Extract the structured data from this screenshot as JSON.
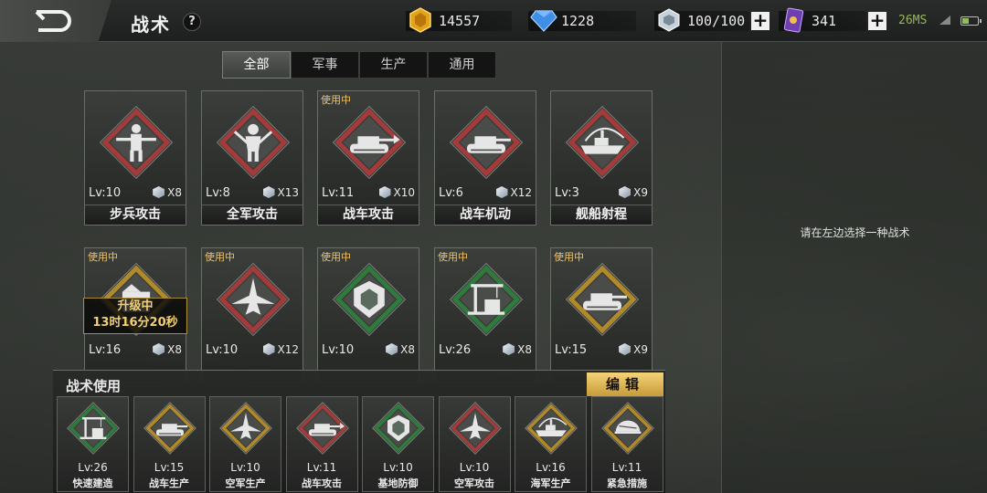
{
  "header": {
    "title": "战术",
    "help_glyph": "?",
    "resources": [
      {
        "name": "gold-coin-icon",
        "value": "14557"
      },
      {
        "name": "diamond-icon",
        "value": "1228"
      },
      {
        "name": "crystal-cube-icon",
        "value": "100/100"
      },
      {
        "name": "purple-card-icon",
        "value": "341"
      }
    ],
    "plus_glyph": "+",
    "ping": "26MS"
  },
  "tabs": [
    {
      "label": "全部",
      "active": true
    },
    {
      "label": "军事",
      "active": false
    },
    {
      "label": "生产",
      "active": false
    },
    {
      "label": "通用",
      "active": false
    }
  ],
  "cards": [
    {
      "name": "步兵攻击",
      "level": "Lv:10",
      "count": "X8",
      "in_use": "",
      "color": "#a33b3b",
      "icon": "infantry-icon"
    },
    {
      "name": "全军攻击",
      "level": "Lv:8",
      "count": "X13",
      "in_use": "",
      "color": "#a33b3b",
      "icon": "soldier-icon"
    },
    {
      "name": "战车攻击",
      "level": "Lv:11",
      "count": "X10",
      "in_use": "使用中",
      "color": "#a33b3b",
      "icon": "tank-fire-icon"
    },
    {
      "name": "战车机动",
      "level": "Lv:6",
      "count": "X12",
      "in_use": "",
      "color": "#a33b3b",
      "icon": "tank-icon"
    },
    {
      "name": "舰船射程",
      "level": "Lv:3",
      "count": "X9",
      "in_use": "",
      "color": "#a33b3b",
      "icon": "warship-icon"
    },
    {
      "name": "",
      "level": "Lv:16",
      "count": "X8",
      "in_use": "使用中",
      "color": "#b08a2a",
      "icon": "factory-icon",
      "upgrade_title": "升级中",
      "upgrade_time": "13时16分20秒"
    },
    {
      "name": "",
      "level": "Lv:10",
      "count": "X12",
      "in_use": "使用中",
      "color": "#a33b3b",
      "icon": "jet-icon"
    },
    {
      "name": "",
      "level": "Lv:10",
      "count": "X8",
      "in_use": "使用中",
      "color": "#2f7a3d",
      "icon": "shield-icon"
    },
    {
      "name": "",
      "level": "Lv:26",
      "count": "X8",
      "in_use": "使用中",
      "color": "#2f7a3d",
      "icon": "crane-icon"
    },
    {
      "name": "",
      "level": "Lv:15",
      "count": "X9",
      "in_use": "使用中",
      "color": "#b08a2a",
      "icon": "tank-icon"
    }
  ],
  "right_panel": {
    "hint": "请在左边选择一种战术"
  },
  "dock": {
    "title": "战术使用",
    "edit_label": "编辑",
    "slots": [
      {
        "level": "Lv:26",
        "name": "快速建造",
        "color": "#2f7a3d",
        "icon": "crane-icon"
      },
      {
        "level": "Lv:15",
        "name": "战车生产",
        "color": "#b08a2a",
        "icon": "tank-icon"
      },
      {
        "level": "Lv:10",
        "name": "空军生产",
        "color": "#b08a2a",
        "icon": "jet-icon"
      },
      {
        "level": "Lv:11",
        "name": "战车攻击",
        "color": "#a33b3b",
        "icon": "tank-fire-icon"
      },
      {
        "level": "Lv:10",
        "name": "基地防御",
        "color": "#2f7a3d",
        "icon": "shield-icon"
      },
      {
        "level": "Lv:10",
        "name": "空军攻击",
        "color": "#a33b3b",
        "icon": "jet-icon"
      },
      {
        "level": "Lv:16",
        "name": "海军生产",
        "color": "#b08a2a",
        "icon": "warship-icon"
      },
      {
        "level": "Lv:11",
        "name": "紧急措施",
        "color": "#b08a2a",
        "icon": "helmet-icon"
      }
    ]
  }
}
